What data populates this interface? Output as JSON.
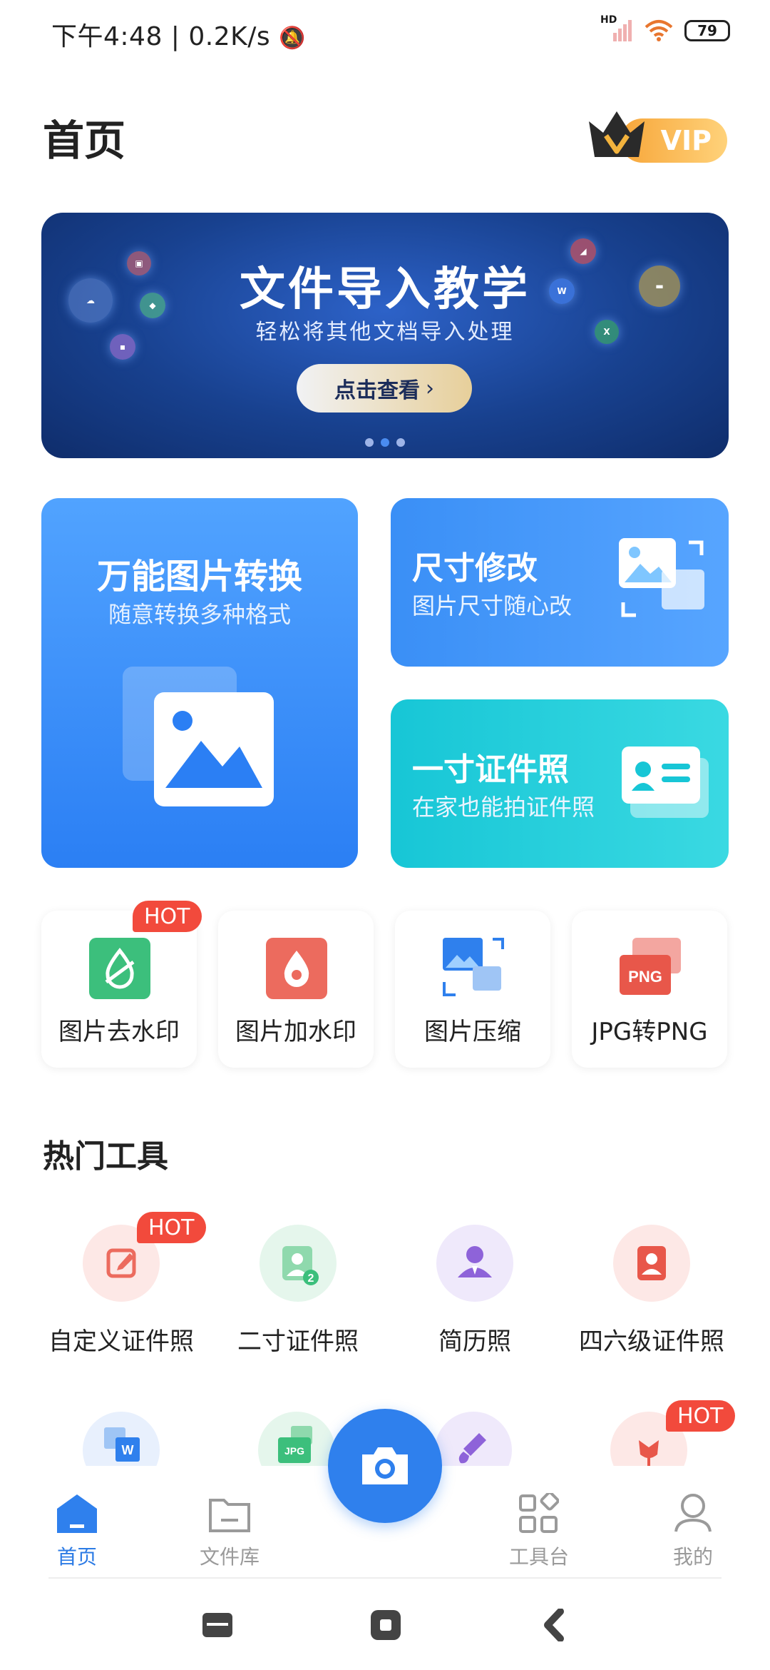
{
  "status_bar": {
    "time": "下午4:48",
    "network_speed": "0.2K/s",
    "signal_label": "HD",
    "battery": "79"
  },
  "header": {
    "title": "首页",
    "vip_label": "VIP"
  },
  "banner": {
    "title": "文件导入教学",
    "subtitle": "轻松将其他文档导入处理",
    "button_label": "点击查看",
    "page_count": 3,
    "active_page": 2
  },
  "feature_cards": {
    "convert": {
      "title": "万能图片转换",
      "subtitle": "随意转换多种格式"
    },
    "resize": {
      "title": "尺寸修改",
      "subtitle": "图片尺寸随心改"
    },
    "id_photo": {
      "title": "一寸证件照",
      "subtitle": "在家也能拍证件照"
    }
  },
  "quick_tools": [
    {
      "label": "图片去水印",
      "badge": "HOT"
    },
    {
      "label": "图片加水印"
    },
    {
      "label": "图片压缩"
    },
    {
      "label": "JPG转PNG",
      "icon_text": "PNG"
    }
  ],
  "hot_tools": {
    "title": "热门工具",
    "items": [
      {
        "label": "自定义证件照",
        "badge": "HOT"
      },
      {
        "label": "二寸证件照"
      },
      {
        "label": "简历照"
      },
      {
        "label": "四六级证件照"
      }
    ],
    "row2_badge": "HOT",
    "row2_icon_w": "W",
    "row2_icon_jpg": "JPG"
  },
  "bottom_nav": {
    "items": [
      {
        "label": "首页"
      },
      {
        "label": "文件库"
      },
      {
        "label": "工具台"
      },
      {
        "label": "我的"
      }
    ]
  },
  "colors": {
    "primary": "#2f80ed",
    "hot_badge": "#f24a3c",
    "banner_bg": "#18418f",
    "id_card": "#17c6d6"
  }
}
